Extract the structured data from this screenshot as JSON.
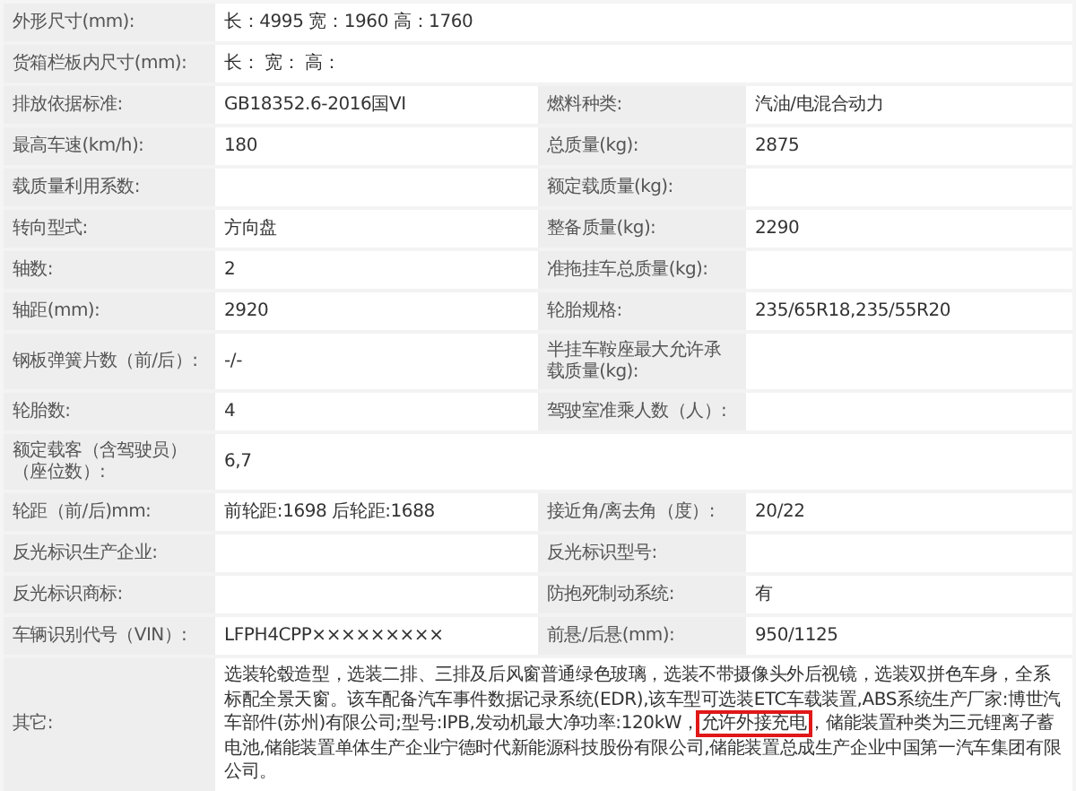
{
  "rows": [
    {
      "pairs": [
        {
          "label": "外形尺寸(mm):",
          "value": "长：4995 宽：1960 高：1760"
        }
      ]
    },
    {
      "pairs": [
        {
          "label": "货箱栏板内尺寸(mm):",
          "value": "长： 宽： 高："
        }
      ]
    },
    {
      "pairs": [
        {
          "label": "排放依据标准:",
          "value": "GB18352.6-2016国VI"
        },
        {
          "label": "燃料种类:",
          "value": "汽油/电混合动力"
        }
      ]
    },
    {
      "pairs": [
        {
          "label": "最高车速(km/h):",
          "value": "180"
        },
        {
          "label": "总质量(kg):",
          "value": "2875"
        }
      ]
    },
    {
      "pairs": [
        {
          "label": "载质量利用系数:"
        },
        {
          "label": "额定载质量(kg):"
        }
      ]
    },
    {
      "pairs": [
        {
          "label": "转向型式:",
          "value": "方向盘"
        },
        {
          "label": "整备质量(kg):",
          "value": "2290"
        }
      ]
    },
    {
      "pairs": [
        {
          "label": "轴数:",
          "value": "2"
        },
        {
          "label": "准拖挂车总质量(kg):"
        }
      ]
    },
    {
      "pairs": [
        {
          "label": "轴距(mm):",
          "value": "2920"
        },
        {
          "label": "轮胎规格:",
          "value": "235/65R18,235/55R20"
        }
      ]
    },
    {
      "pairs": [
        {
          "label": "钢板弹簧片数（前/后）:",
          "value": "-/-"
        },
        {
          "label": "半挂车鞍座最大允许承载质量(kg):"
        }
      ]
    },
    {
      "pairs": [
        {
          "label": "轮胎数:",
          "value": "4"
        },
        {
          "label": "驾驶室准乘人数（人）:"
        }
      ]
    },
    {
      "pairs": [
        {
          "label": "额定载客（含驾驶员）（座位数）:",
          "value": "6,7"
        }
      ]
    },
    {
      "pairs": [
        {
          "label": "轮距（前/后)mm:",
          "value": "前轮距:1698 后轮距:1688"
        },
        {
          "label": "接近角/离去角（度）:",
          "value": "20/22"
        }
      ]
    },
    {
      "pairs": [
        {
          "label": "反光标识生产企业:"
        },
        {
          "label": "反光标识型号:"
        }
      ]
    },
    {
      "pairs": [
        {
          "label": "反光标识商标:"
        },
        {
          "label": "防抱死制动系统:",
          "value": "有"
        }
      ]
    },
    {
      "pairs": [
        {
          "label": "车辆识别代号（VIN）:",
          "value": "LFPH4CPP×××××××××"
        },
        {
          "label": "前悬/后悬(mm):",
          "value": "950/1125"
        }
      ]
    }
  ],
  "other": {
    "label": "其它:",
    "parts": [
      {
        "text": "选装轮毂造型，选装二排、三排及后风窗普通绿色玻璃，选装不带摄像头外后视镜，选装双拼色车身，全系标配全景天窗。该车配备汽车事件数据记录系统(EDR),该车型可选装ETC车载装置,ABS系统生产厂家:博世汽车部件(苏州)有限公司;型号:IPB,发动机最大净功率:120kW，",
        "highlighted": false
      },
      {
        "text": "允许外接充电",
        "highlighted": true
      },
      {
        "text": "，储能装置种类为三元锂离子蓄电池,储能装置单体生产企业宁德时代新能源科技股份有限公司,储能装置总成生产企业中国第一汽车集团有限公司。",
        "highlighted": false
      }
    ]
  }
}
